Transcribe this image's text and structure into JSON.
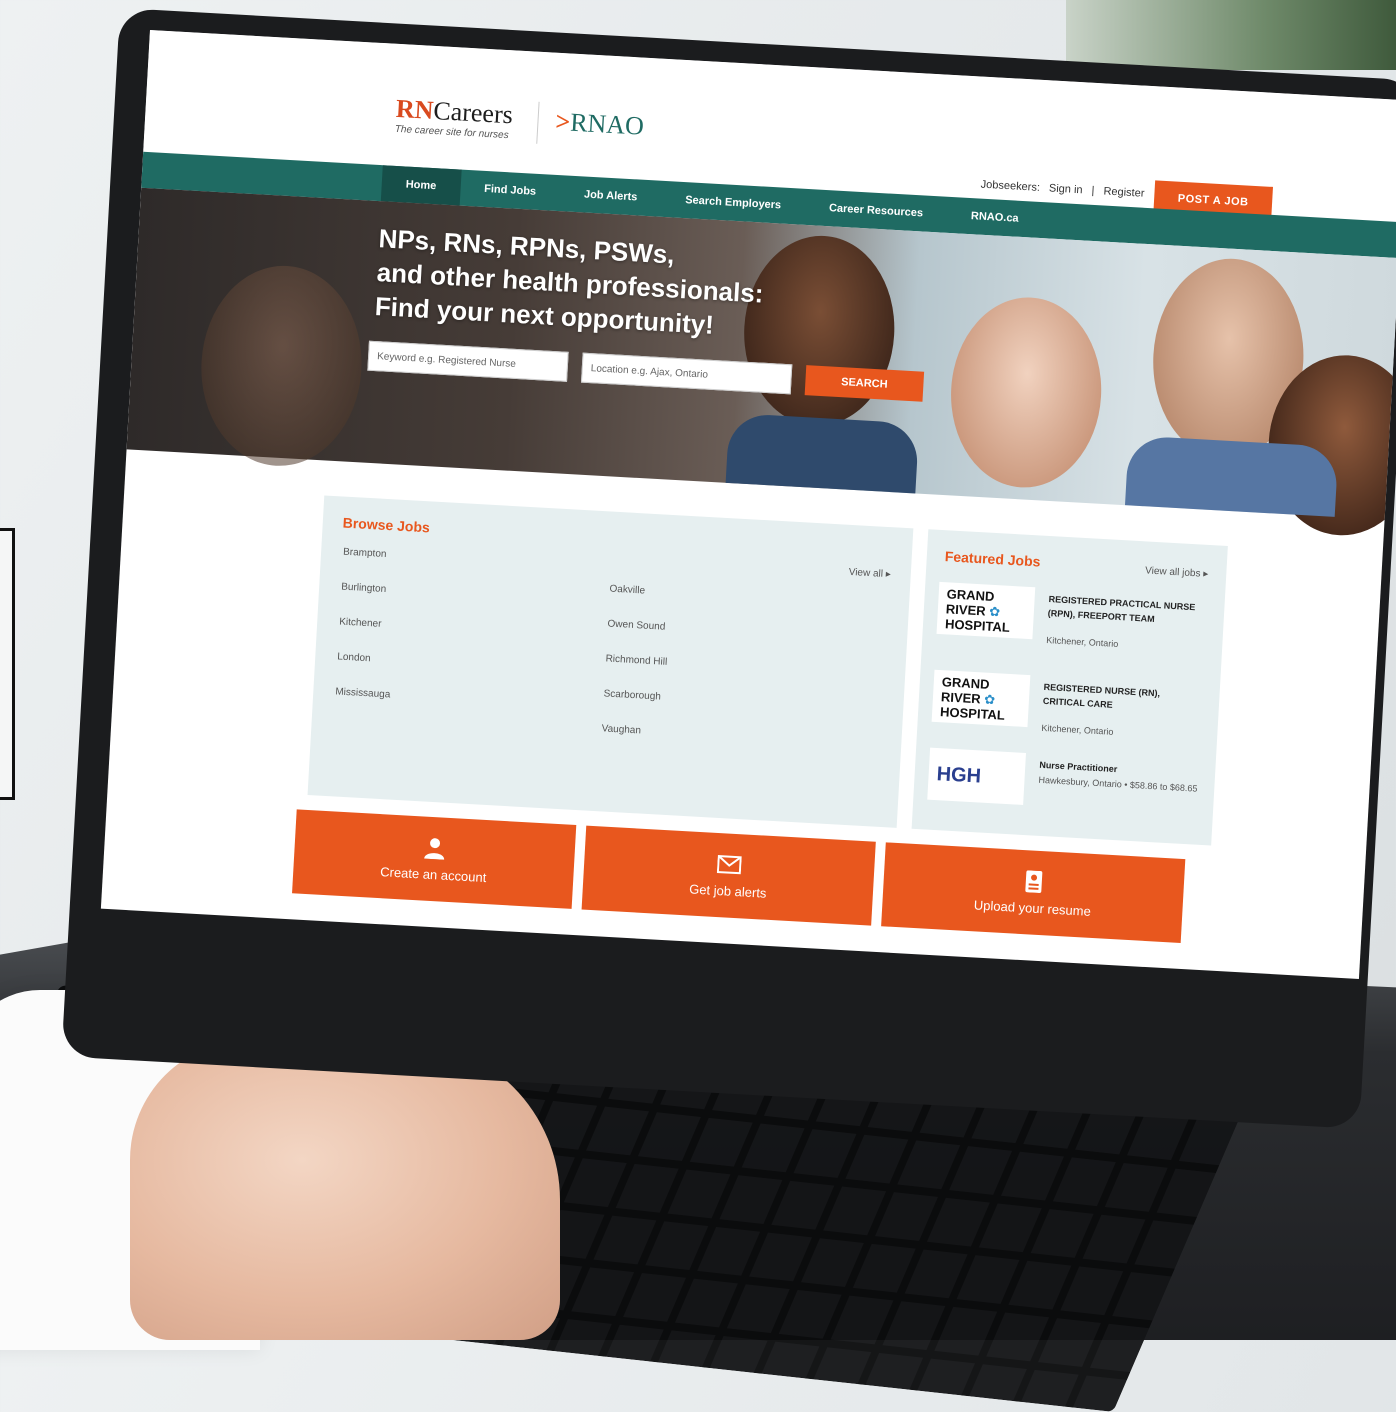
{
  "brand": {
    "rn": "RN",
    "careers": "Careers",
    "tagline": "The career site for nurses",
    "rnao": "RNAO",
    "arrow": ">"
  },
  "header": {
    "jobseekers_label": "Jobseekers:",
    "sign_in": "Sign in",
    "separator": "|",
    "register": "Register",
    "post_job": "POST A JOB"
  },
  "nav": {
    "items": [
      "Home",
      "Find Jobs",
      "Job Alerts",
      "Search Employers",
      "Career Resources",
      "RNAO.ca"
    ]
  },
  "hero": {
    "line1": "NPs, RNs, RPNs, PSWs,",
    "line2": "and other health professionals:",
    "line3": "Find your next opportunity!",
    "keyword_placeholder": "Keyword e.g. Registered Nurse",
    "location_placeholder": "Location e.g. Ajax, Ontario",
    "search_label": "SEARCH"
  },
  "browse": {
    "title": "Browse Jobs",
    "view_all": "View all ▸",
    "col1": [
      "Brampton",
      "Burlington",
      "Kitchener",
      "London",
      "Mississauga"
    ],
    "col2": [
      "Oakville",
      "Owen Sound",
      "Richmond Hill",
      "Scarborough",
      "Vaughan"
    ]
  },
  "featured": {
    "title": "Featured Jobs",
    "view_all": "View all jobs ▸",
    "jobs": [
      {
        "logo_l1": "GRAND",
        "logo_l2": "RIVER",
        "logo_l3": "HOSPITAL",
        "title": "REGISTERED PRACTICAL NURSE (RPN), FREEPORT TEAM",
        "location": "Kitchener, Ontario"
      },
      {
        "logo_l1": "GRAND",
        "logo_l2": "RIVER",
        "logo_l3": "HOSPITAL",
        "title": "REGISTERED NURSE (RN), CRITICAL CARE",
        "location": "Kitchener, Ontario"
      },
      {
        "logo": "HGH",
        "title": "Nurse Practitioner",
        "location": "Hawkesbury, Ontario • $58.86 to $68.65"
      }
    ]
  },
  "cta": {
    "create_account": "Create an account",
    "job_alerts": "Get job alerts",
    "upload_resume": "Upload your resume"
  },
  "colors": {
    "accent": "#e8571e",
    "brand_teal": "#1f6b63",
    "panel": "#e6eff0"
  },
  "icons": {
    "account": "person-icon",
    "alerts": "envelope-icon",
    "resume": "document-icon"
  }
}
